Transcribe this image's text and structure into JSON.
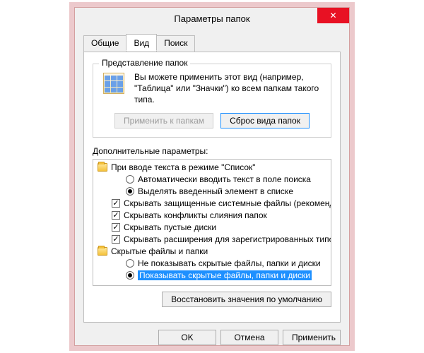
{
  "title": "Параметры папок",
  "tabs": {
    "general": "Общие",
    "view": "Вид",
    "search": "Поиск"
  },
  "groupbox": {
    "title": "Представление папок",
    "text": "Вы можете применить этот вид (например, \"Таблица\" или \"Значки\") ко всем папкам такого типа.",
    "apply_to_folders": "Применить к папкам",
    "reset_folders": "Сброс вида папок"
  },
  "adv_label": "Дополнительные параметры:",
  "tree": {
    "group_input": "При вводе текста в режиме \"Список\"",
    "opt_input_search": "Автоматически вводить текст в поле поиска",
    "opt_input_select": "Выделять введенный элемент в списке",
    "chk_hide_protected": "Скрывать защищенные системные файлы (рекомендуется)",
    "chk_hide_merge": "Скрывать конфликты слияния папок",
    "chk_hide_empty": "Скрывать пустые диски",
    "chk_hide_ext": "Скрывать расширения для зарегистрированных типов файлов",
    "group_hidden": "Скрытые файлы и папки",
    "opt_dont_show": "Не показывать скрытые файлы, папки и диски",
    "opt_show": "Показывать скрытые файлы, папки и диски"
  },
  "restore_defaults": "Восстановить значения по умолчанию",
  "footer": {
    "ok": "OK",
    "cancel": "Отмена",
    "apply": "Применить"
  }
}
